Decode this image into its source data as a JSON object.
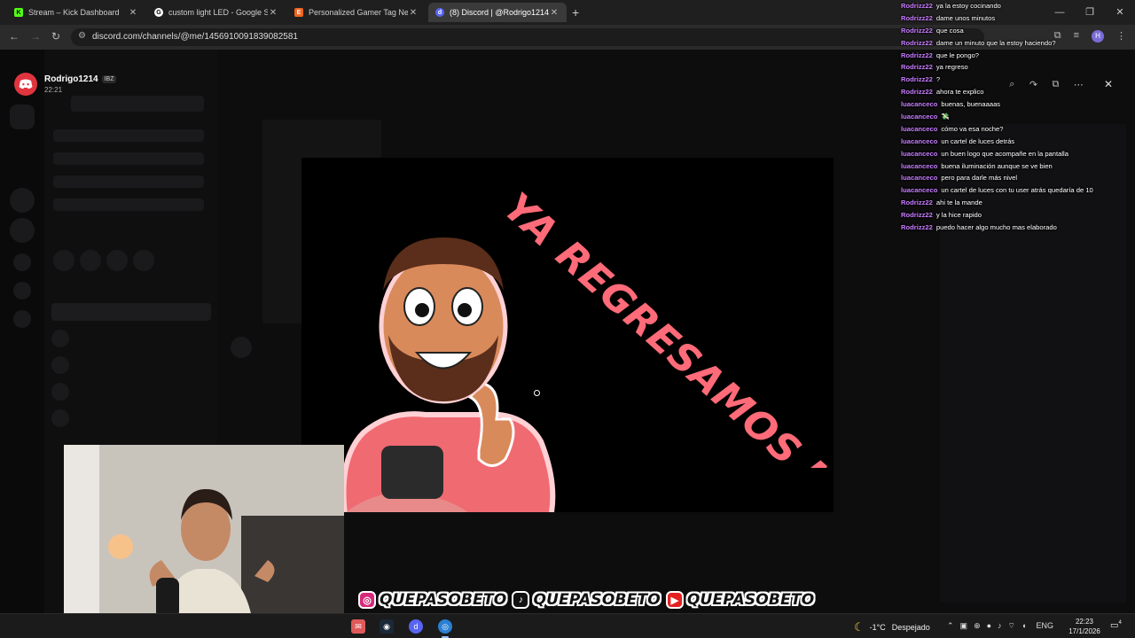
{
  "browser": {
    "tabs": [
      {
        "title": "Stream – Kick Dashboard",
        "favicon": "kick-icon",
        "color": "#53fc18",
        "active": false
      },
      {
        "title": "custom light LED - Google Sea",
        "favicon": "google-icon",
        "color": "#ffffff",
        "active": false
      },
      {
        "title": "Personalized Gamer Tag Neon",
        "favicon": "etsy-icon",
        "color": "#f1641e",
        "active": false
      },
      {
        "title": "(8) Discord | @Rodrigo1214",
        "favicon": "discord-icon",
        "color": "#5865f2",
        "active": true
      }
    ],
    "url": "discord.com/channels/@me/1456910091839082581",
    "profile_initial": "H"
  },
  "viewer": {
    "username": "Rodrigo1214",
    "badge": "IBZ",
    "timestamp": "22:21",
    "tool_icons": [
      "zoom-icon",
      "forward-icon",
      "open-external-icon",
      "more-icon"
    ]
  },
  "image": {
    "slogan_text": "YA REGRESAMOS MIJO...",
    "slogan_color": "#ff6b78"
  },
  "overlay": {
    "socials": [
      {
        "platform": "instagram-icon",
        "glyph": "◎",
        "color": "#d6297a",
        "handle": "QUEPASOBETO"
      },
      {
        "platform": "tiktok-icon",
        "glyph": "♪",
        "color": "#111111",
        "handle": "QUEPASOBETO"
      },
      {
        "platform": "youtube-icon",
        "glyph": "▶",
        "color": "#e52020",
        "handle": "QUEPASOBETO"
      }
    ]
  },
  "chat": {
    "user_color": "#c77dff",
    "messages": [
      {
        "user": "Rodrizz22",
        "text": "ya la estoy cocinando"
      },
      {
        "user": "Rodrizz22",
        "text": "dame unos minutos"
      },
      {
        "user": "Rodrizz22",
        "text": "que cosa"
      },
      {
        "user": "Rodrizz22",
        "text": "dame un minuto que la estoy haciendo?"
      },
      {
        "user": "Rodrizz22",
        "text": "que le pongo?"
      },
      {
        "user": "Rodrizz22",
        "text": "ya regreso"
      },
      {
        "user": "Rodrizz22",
        "text": "?"
      },
      {
        "user": "Rodrizz22",
        "text": "ahora te explico"
      },
      {
        "user": "luacanceco",
        "text": "buenas, buenaaaas"
      },
      {
        "user": "luacanceco",
        "text": "💸"
      },
      {
        "user": "luacanceco",
        "text": "cómo va esa noche?"
      },
      {
        "user": "luacanceco",
        "text": "un cartel de luces detrás"
      },
      {
        "user": "luacanceco",
        "text": "un buen logo que acompañe en la pantalla"
      },
      {
        "user": "luacanceco",
        "text": "buena iluminación aunque se ve bien"
      },
      {
        "user": "luacanceco",
        "text": "pero para darle más nivel"
      },
      {
        "user": "luacanceco",
        "text": "un cartel de luces con tu user atrás quedaría de 10"
      },
      {
        "user": "Rodrizz22",
        "text": "ahi te la mande"
      },
      {
        "user": "Rodrizz22",
        "text": "y la hice rapido"
      },
      {
        "user": "Rodrizz22",
        "text": "puedo hacer algo mucho mas elaborado"
      }
    ]
  },
  "taskbar": {
    "weather_temp": "-1°C",
    "weather_desc": "Despejado",
    "language": "ENG",
    "time": "22:23",
    "date": "17/1/2026",
    "notification_count": "4"
  }
}
